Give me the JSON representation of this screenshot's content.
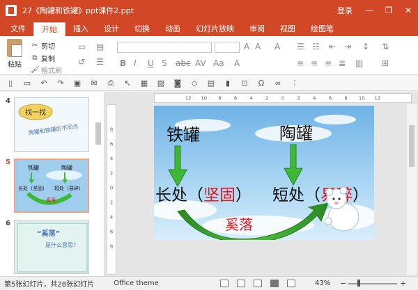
{
  "window": {
    "title": "27《陶罐和铁罐》ppt课件2.ppt",
    "login": "登录",
    "minimize_glyph": "—",
    "restore_glyph": "❐",
    "close_glyph": "✕"
  },
  "ribbon": {
    "tabs": [
      "文件",
      "开始",
      "插入",
      "设计",
      "切换",
      "动画",
      "幻灯片放映",
      "审阅",
      "视图",
      "绘图笔"
    ],
    "active_tab": "开始",
    "paste": "粘贴",
    "cut": "剪切",
    "copy": "复制",
    "format_painter": "格式刷"
  },
  "thumbnails": [
    {
      "number": "4",
      "title": "找一找",
      "caption": "陶罐和铁罐的不同点"
    },
    {
      "number": "5",
      "left_word": "铁罐",
      "right_word": "陶罐",
      "left_line": "长处（坚固）",
      "right_line": "短处（易碎）",
      "center": "奚落"
    },
    {
      "number": "6",
      "title": "“奚落”",
      "caption": "是什么意思？"
    }
  ],
  "slide": {
    "label_iron_jar": "铁罐",
    "label_clay_jar": "陶罐",
    "left_prefix": "长处（",
    "left_highlight": "坚固",
    "left_suffix": "）",
    "right_prefix": "短处（",
    "right_highlight": "易碎",
    "right_suffix": "）",
    "center_word": "奚落"
  },
  "ruler": {
    "h_ticks": [
      "12",
      "10",
      "8",
      "6",
      "4",
      "2",
      "0",
      "2",
      "4",
      "6",
      "8",
      "10",
      "12"
    ],
    "v_ticks": [
      "8",
      "6",
      "4",
      "2",
      "0",
      "2",
      "4",
      "6",
      "8"
    ]
  },
  "status": {
    "slide_info": "第5张幻灯片，共28张幻灯片",
    "theme": "Office theme",
    "zoom": "43%",
    "zoom_minus": "−",
    "zoom_plus": "+"
  },
  "colors": {
    "accent": "#d24726",
    "highlight_red": "#e8141c",
    "arrow_green": "#3fb935",
    "arrow_green_dark": "#2a8a22"
  }
}
